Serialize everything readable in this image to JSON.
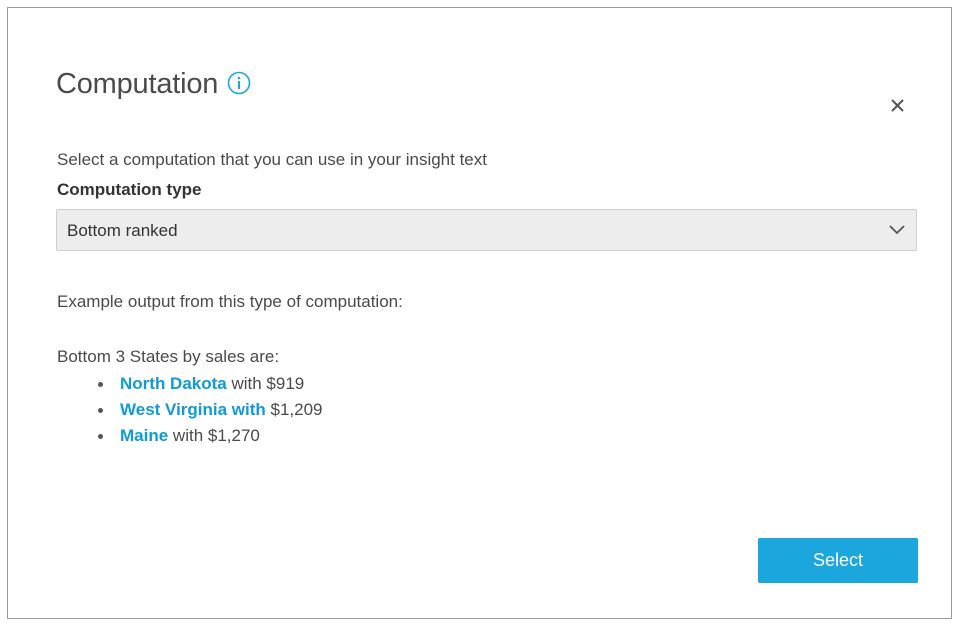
{
  "dialog": {
    "title": "Computation",
    "description": "Select a computation that you can use in your insight text",
    "field_label": "Computation type",
    "select_value": "Bottom ranked",
    "example_label": "Example output from this type of computation:",
    "example_heading": "Bottom 3 States by sales are:",
    "items": [
      {
        "link": "North Dakota",
        "text": " with $919"
      },
      {
        "link": "West Virginia with",
        "text": " $1,209"
      },
      {
        "link": "Maine",
        "text": " with $1,270"
      }
    ],
    "select_button": "Select"
  },
  "icons": {
    "info": "info-icon",
    "close": "close-icon",
    "dropdown": "chevron-down-icon"
  },
  "colors": {
    "accent": "#1ba6de",
    "link": "#0f9bd7"
  }
}
